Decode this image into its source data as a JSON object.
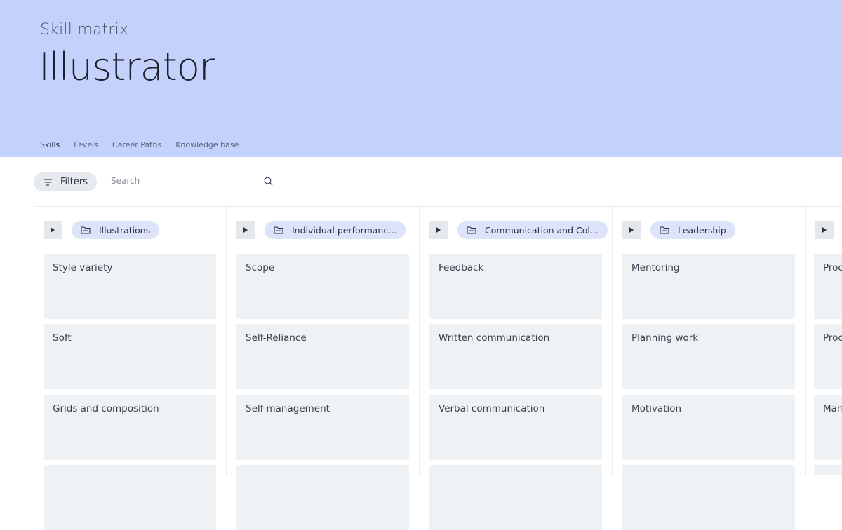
{
  "header": {
    "subtitle": "Skill matrix",
    "title": "Illustrator",
    "tabs": [
      {
        "label": "Skills",
        "active": true
      },
      {
        "label": "Levels"
      },
      {
        "label": "Career Paths"
      },
      {
        "label": "Knowledge base"
      }
    ]
  },
  "toolbar": {
    "filters_label": "Filters",
    "search_placeholder": "Search"
  },
  "columns": [
    {
      "category": "Illustrations",
      "skills": [
        "Style variety",
        "Soft",
        "Grids and composition",
        ""
      ]
    },
    {
      "category": "Individual performanc...",
      "skills": [
        "Scope",
        "Self-Reliance",
        "Self-management",
        ""
      ]
    },
    {
      "category": "Communication and Col...",
      "skills": [
        "Feedback",
        "Written communication",
        "Verbal communication",
        ""
      ]
    },
    {
      "category": "Leadership",
      "skills": [
        "Mentoring",
        "Planning work",
        "Motivation",
        ""
      ]
    },
    {
      "category": "",
      "skills": [
        "Proc",
        "Proc",
        "Mark",
        ""
      ]
    }
  ],
  "colors": {
    "header_bg": "#c4d1fa",
    "card_bg": "#eff2f5",
    "chip_bg": "#dde3f8"
  }
}
